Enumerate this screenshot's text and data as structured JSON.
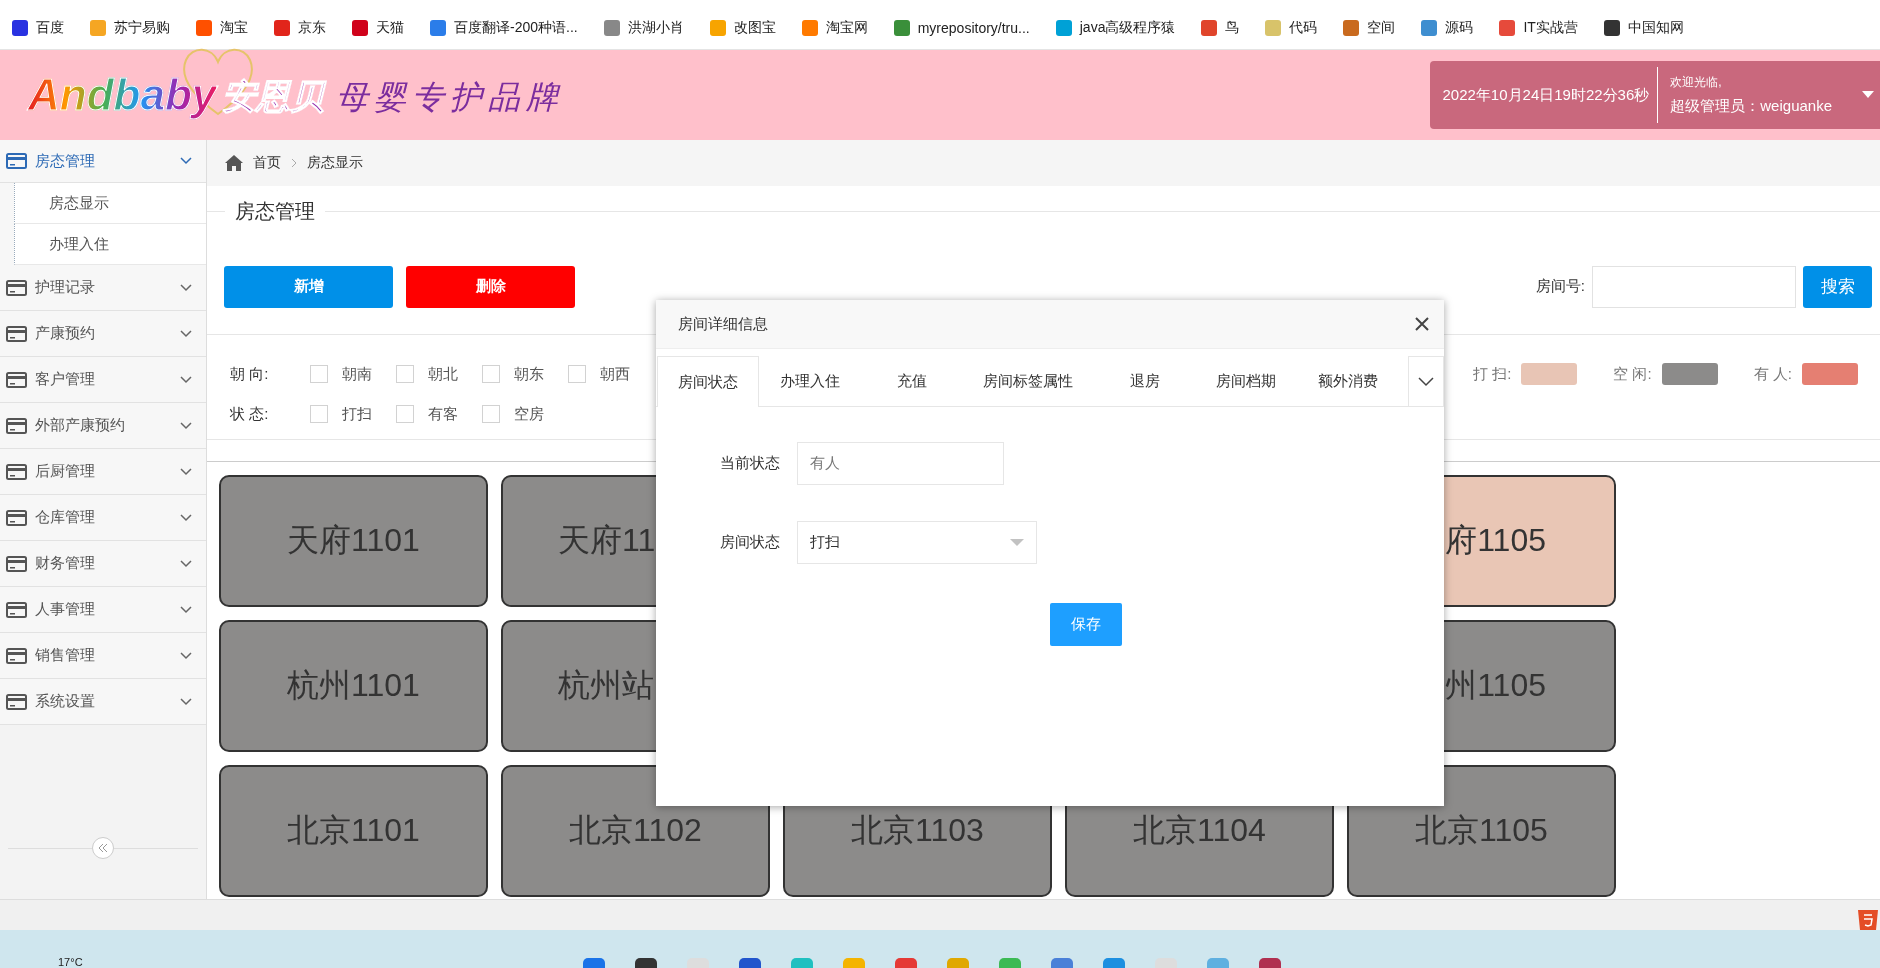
{
  "bookmarks": [
    {
      "label": "百度",
      "color": "#2932e1"
    },
    {
      "label": "苏宁易购",
      "color": "#f5a623"
    },
    {
      "label": "淘宝",
      "color": "#ff5000"
    },
    {
      "label": "京东",
      "color": "#e1251b"
    },
    {
      "label": "天猫",
      "color": "#d0021b"
    },
    {
      "label": "百度翻译-200种语...",
      "color": "#2b7de9"
    },
    {
      "label": "洪湖小肖",
      "color": "#888888"
    },
    {
      "label": "改图宝",
      "color": "#f7a400"
    },
    {
      "label": "淘宝网",
      "color": "#ff7a00"
    },
    {
      "label": "myrepository/tru...",
      "color": "#3a8f3a"
    },
    {
      "label": "java高级程序猿",
      "color": "#00a1d6"
    },
    {
      "label": "鸟",
      "color": "#e0452b"
    },
    {
      "label": "代码",
      "color": "#d8c36a"
    },
    {
      "label": "空间",
      "color": "#c96a1e"
    },
    {
      "label": "源码",
      "color": "#3e8ed0"
    },
    {
      "label": "IT实战营",
      "color": "#e64a3b"
    },
    {
      "label": "中国知网",
      "color": "#333333"
    }
  ],
  "header": {
    "brand": "Andbaby",
    "cn_brand": "安恩贝",
    "slogan": "母婴专护品牌",
    "datetime": "2022年10月24日19时22分36秒",
    "greeting": "欢迎光临,",
    "user": "超级管理员：weiguanke"
  },
  "sidebar": {
    "items": [
      {
        "label": "房态管理",
        "expanded": true,
        "children": [
          {
            "label": "房态显示"
          },
          {
            "label": "办理入住"
          }
        ]
      },
      {
        "label": "护理记录",
        "expanded": false
      },
      {
        "label": "产康预约",
        "expanded": false
      },
      {
        "label": "客户管理",
        "expanded": false
      },
      {
        "label": "外部产康预约",
        "expanded": false
      },
      {
        "label": "后厨管理",
        "expanded": false
      },
      {
        "label": "仓库管理",
        "expanded": false
      },
      {
        "label": "财务管理",
        "expanded": false
      },
      {
        "label": "人事管理",
        "expanded": false
      },
      {
        "label": "销售管理",
        "expanded": false
      },
      {
        "label": "系统设置",
        "expanded": false
      }
    ]
  },
  "breadcrumb": [
    "首页",
    "房态显示"
  ],
  "page_title": "房态管理",
  "actions": [
    {
      "label": "新增",
      "kind": "primary"
    },
    {
      "label": "删除",
      "kind": "danger"
    }
  ],
  "search": {
    "label": "房间号:",
    "button": "搜索"
  },
  "filters": [
    {
      "label": "朝 向:",
      "options": [
        {
          "label": "朝南",
          "checked": false
        },
        {
          "label": "朝北",
          "checked": false
        },
        {
          "label": "朝东",
          "checked": false
        },
        {
          "label": "朝西",
          "checked": false
        }
      ]
    },
    {
      "label": "状 态:",
      "options": [
        {
          "label": "打扫",
          "checked": false
        },
        {
          "label": "有客",
          "checked": false
        },
        {
          "label": "空房",
          "checked": false
        }
      ]
    }
  ],
  "legend": [
    {
      "label": "打 扫:",
      "color": "#e8c5b5"
    },
    {
      "label": "空 闲:",
      "color": "#8c8b8a"
    },
    {
      "label": "有 人:",
      "color": "#e57f72"
    }
  ],
  "rooms": [
    [
      {
        "label": "天府1101",
        "color": "#8c8b8a",
        "kind": "full"
      },
      {
        "label": "天府11",
        "color": "#8c8b8a",
        "kind": "clipped_end"
      },
      {
        "label": "府1105",
        "color": "#e9c6b5",
        "kind": "clipped_start"
      }
    ],
    [
      {
        "label": "杭州1101",
        "color": "#8c8b8a",
        "kind": "full"
      },
      {
        "label": "杭州站",
        "color": "#8c8b8a",
        "kind": "clipped_end"
      },
      {
        "label": "州1105",
        "color": "#8c8b8a",
        "kind": "clipped_start"
      }
    ],
    [
      {
        "label": "北京1101",
        "color": "#8c8b8a",
        "kind": "full"
      },
      {
        "label": "北京1102",
        "color": "#8c8b8a",
        "kind": "full"
      },
      {
        "label": "北京1103",
        "color": "#8c8b8a",
        "kind": "full"
      },
      {
        "label": "北京1104",
        "color": "#8c8b8a",
        "kind": "full"
      },
      {
        "label": "北京1105",
        "color": "#8c8b8a",
        "kind": "full"
      }
    ]
  ],
  "dialog": {
    "title": "房间详细信息",
    "tabs": [
      {
        "label": "房间状态",
        "selected": true
      },
      {
        "label": "办理入住",
        "selected": false
      },
      {
        "label": "充值",
        "selected": false
      },
      {
        "label": "房间标签属性",
        "selected": false
      },
      {
        "label": "退房",
        "selected": false
      },
      {
        "label": "房间档期",
        "selected": false
      },
      {
        "label": "额外消费",
        "selected": false
      }
    ],
    "fields": [
      {
        "label": "当前状态",
        "kind": "readonly",
        "value": "有人"
      },
      {
        "label": "房间状态",
        "kind": "select",
        "value": "打扫"
      }
    ],
    "save": "保存"
  },
  "taskbar": {
    "weather": "17°C"
  }
}
